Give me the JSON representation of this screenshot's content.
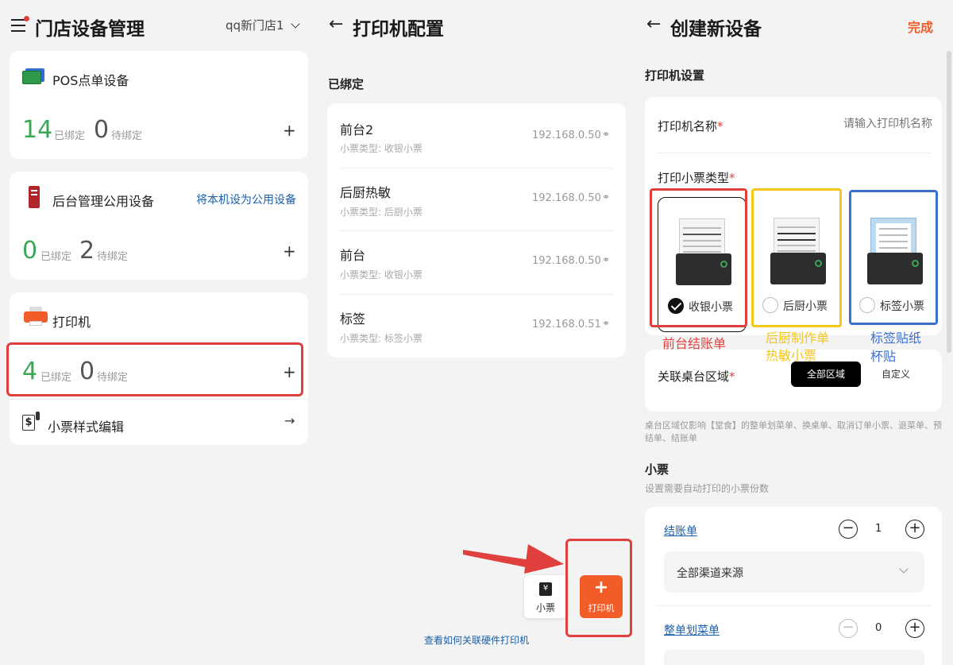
{
  "col1": {
    "title": "门店设备管理",
    "store": "qq新门店1",
    "pos": {
      "title": "POS点单设备",
      "bound": "14",
      "bound_label": "已绑定",
      "pending": "0",
      "pending_label": "待绑定"
    },
    "admin": {
      "title": "后台管理公用设备",
      "action": "将本机设为公用设备",
      "bound": "0",
      "bound_label": "已绑定",
      "pending": "2",
      "pending_label": "待绑定"
    },
    "printer": {
      "title": "打印机",
      "bound": "4",
      "bound_label": "已绑定",
      "pending": "0",
      "pending_label": "待绑定"
    },
    "ticket_style": {
      "title": "小票样式编辑"
    }
  },
  "col2": {
    "title": "打印机配置",
    "section": "已绑定",
    "rows": [
      {
        "name": "前台2",
        "type": "小票类型: 收银小票",
        "ip": "192.168.0.50"
      },
      {
        "name": "后厨热敏",
        "type": "小票类型: 后厨小票",
        "ip": "192.168.0.50"
      },
      {
        "name": "前台",
        "type": "小票类型: 收银小票",
        "ip": "192.168.0.50"
      },
      {
        "name": "标签",
        "type": "小票类型: 标签小票",
        "ip": "192.168.0.51"
      }
    ],
    "fab_ticket": "小票",
    "fab_printer": "打印机",
    "help_link": "查看如何关联硬件打印机"
  },
  "col3": {
    "title": "创建新设备",
    "done": "完成",
    "section_printer": "打印机设置",
    "name_label": "打印机名称",
    "name_placeholder": "请输入打印机名称",
    "type_label": "打印小票类型",
    "types": [
      {
        "label": "收银小票",
        "selected": true
      },
      {
        "label": "后厨小票",
        "selected": false
      },
      {
        "label": "标签小票",
        "selected": false
      }
    ],
    "annot1": "前台结账单",
    "annot2a": "后厨制作单",
    "annot2b": "热敏小票",
    "annot3a": "标签贴纸",
    "annot3b": "杯贴",
    "area_label": "关联桌台区域",
    "area_all": "全部区域",
    "area_custom": "自定义",
    "area_note": "桌台区域仅影响【堂食】的整单划菜单、换桌单、取消订单小票、退菜单、预结单、结账单",
    "ticket_section": "小票",
    "ticket_desc": "设置需要自动打印的小票份数",
    "ticket1": {
      "label": "结账单",
      "count": "1",
      "source": "全部渠道来源"
    },
    "ticket2": {
      "label": "整单划菜单",
      "count": "0"
    }
  },
  "colors": {
    "accent": "#f25c29",
    "green": "#3aa757",
    "red": "#e0403d",
    "yellow": "#f5c518",
    "blue": "#3d6fd1"
  }
}
